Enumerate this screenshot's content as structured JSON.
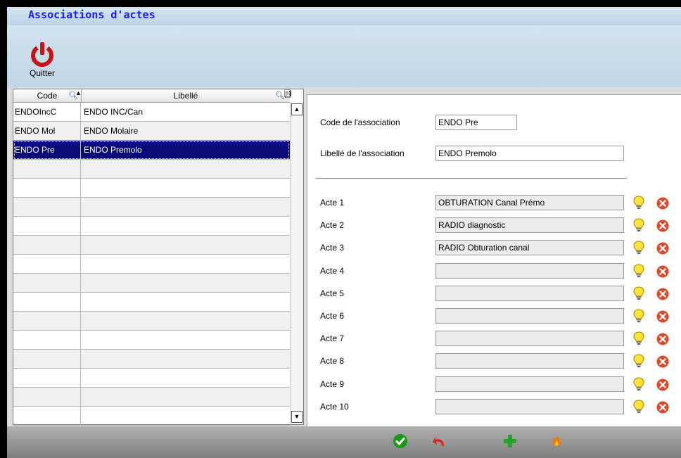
{
  "window": {
    "title": "Associations d'actes"
  },
  "toolbar": {
    "quit_label": "Quitter"
  },
  "grid": {
    "columns": [
      "Code",
      "Libellé"
    ],
    "rows": [
      {
        "code": "ENDOIncC",
        "libelle": "ENDO INC/Can"
      },
      {
        "code": "ENDO Mol",
        "libelle": "ENDO Molaire"
      },
      {
        "code": "ENDO Pre",
        "libelle": "ENDO Premolo"
      },
      {
        "code": "",
        "libelle": ""
      },
      {
        "code": "",
        "libelle": ""
      },
      {
        "code": "",
        "libelle": ""
      },
      {
        "code": "",
        "libelle": ""
      },
      {
        "code": "",
        "libelle": ""
      },
      {
        "code": "",
        "libelle": ""
      },
      {
        "code": "",
        "libelle": ""
      },
      {
        "code": "",
        "libelle": ""
      },
      {
        "code": "",
        "libelle": ""
      },
      {
        "code": "",
        "libelle": ""
      },
      {
        "code": "",
        "libelle": ""
      },
      {
        "code": "",
        "libelle": ""
      },
      {
        "code": "",
        "libelle": ""
      },
      {
        "code": "",
        "libelle": ""
      }
    ],
    "selected_index": 2
  },
  "form": {
    "code_label": "Code de l'association",
    "code_value": "ENDO Pre",
    "libelle_label": "Libellé de l'association",
    "libelle_value": "ENDO Premolo",
    "actes": [
      {
        "label": "Acte 1",
        "value": "OBTURATION Canal Prémo"
      },
      {
        "label": "Acte 2",
        "value": "RADIO diagnostic"
      },
      {
        "label": "Acte 3",
        "value": "RADIO Obturation canal"
      },
      {
        "label": "Acte 4",
        "value": ""
      },
      {
        "label": "Acte 5",
        "value": ""
      },
      {
        "label": "Acte 6",
        "value": ""
      },
      {
        "label": "Acte 7",
        "value": ""
      },
      {
        "label": "Acte 8",
        "value": ""
      },
      {
        "label": "Acte 9",
        "value": ""
      },
      {
        "label": "Acte 10",
        "value": ""
      }
    ]
  },
  "icons": {
    "quit": "power-icon",
    "bulb": "lightbulb-icon",
    "delete": "delete-circle-icon",
    "validate": "checkmark-icon",
    "undo": "undo-arrow-icon",
    "add": "plus-icon",
    "fire": "flame-icon"
  },
  "colors": {
    "title": "#1a1aff",
    "selection": "#0a0a7a",
    "quit": "#c81414",
    "delete": "#e0462c",
    "validate": "#1a9a1a",
    "add": "#2aa02a"
  }
}
